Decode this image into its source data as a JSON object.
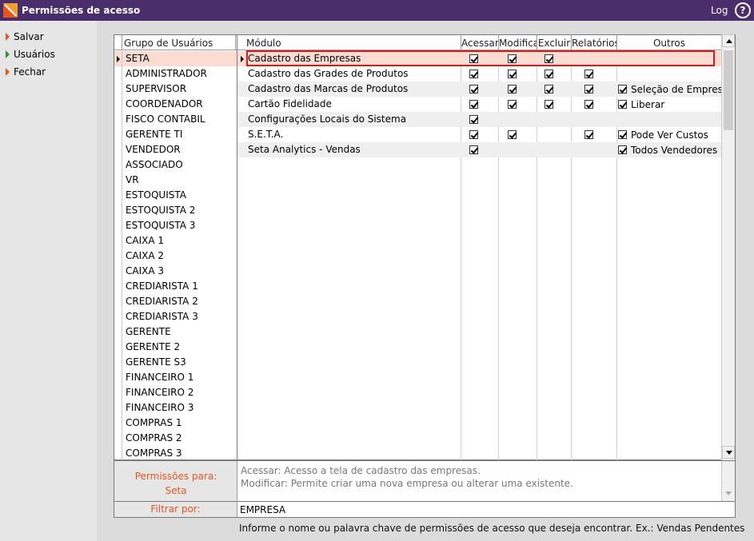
{
  "window": {
    "title": "Permissões de acesso",
    "log_label": "Log",
    "help_glyph": "?"
  },
  "sidebar": {
    "items": [
      {
        "label": "Salvar",
        "icon": "arrow-orange"
      },
      {
        "label": "Usuários",
        "icon": "arrow-green"
      },
      {
        "label": "Fechar",
        "icon": "arrow-orange"
      }
    ]
  },
  "groups": {
    "header": "Grupo de Usuários",
    "selected": 0,
    "items": [
      "SETA",
      "ADMINISTRADOR",
      "SUPERVISOR",
      "COORDENADOR",
      "FISCO CONTABIL",
      "GERENTE TI",
      "VENDEDOR",
      "ASSOCIADO",
      "VR",
      "ESTOQUISTA",
      "ESTOQUISTA 2",
      "ESTOQUISTA 3",
      "CAIXA 1",
      "CAIXA 2",
      "CAIXA 3",
      "CREDIARISTA 1",
      "CREDIARISTA 2",
      "CREDIARISTA 3",
      "GERENTE",
      "GERENTE 2",
      "GERENTE S3",
      "FINANCEIRO 1",
      "FINANCEIRO 2",
      "FINANCEIRO 3",
      "COMPRAS 1",
      "COMPRAS 2",
      "COMPRAS 3"
    ]
  },
  "modules": {
    "headers": {
      "modulo": "Módulo",
      "acessar": "Acessar",
      "modificar": "Modificar",
      "excluir": "Excluir",
      "relatorios": "Relatórios",
      "outros": "Outros"
    },
    "rows": [
      {
        "name": "Cadastro das Empresas",
        "acessar": true,
        "modificar": true,
        "excluir": true,
        "relatorios": false,
        "outros": []
      },
      {
        "name": "Cadastro das Grades de Produtos",
        "acessar": true,
        "modificar": true,
        "excluir": true,
        "relatorios": true,
        "outros": []
      },
      {
        "name": "Cadastro das Marcas de Produtos",
        "acessar": true,
        "modificar": true,
        "excluir": true,
        "relatorios": true,
        "outros": [
          "Seleção de Empresas"
        ]
      },
      {
        "name": "Cartão Fidelidade",
        "acessar": true,
        "modificar": true,
        "excluir": true,
        "relatorios": true,
        "outros": [
          "Liberar"
        ]
      },
      {
        "name": "Configurações Locais do Sistema",
        "acessar": true,
        "modificar": false,
        "excluir": false,
        "relatorios": false,
        "outros": []
      },
      {
        "name": "S.E.T.A.",
        "acessar": true,
        "modificar": true,
        "excluir": false,
        "relatorios": true,
        "outros": [
          "Pode Ver Custos"
        ]
      },
      {
        "name": "Seta Analytics - Vendas",
        "acessar": true,
        "modificar": false,
        "excluir": false,
        "relatorios": false,
        "outros": [
          "Todos Vendedores"
        ]
      }
    ]
  },
  "permissions": {
    "label_line1": "Permissões para:",
    "label_line2": "Seta",
    "desc_line1": "Acessar: Acesso a tela de cadastro das empresas.",
    "desc_line2": "Modificar: Permite criar uma nova empresa ou alterar uma existente."
  },
  "filter": {
    "label": "Filtrar por:",
    "value": "EMPRESA"
  },
  "hint": "Informe o nome ou palavra chave de permissões de acesso que deseja encontrar. Ex.: Vendas Pendentes",
  "colors": {
    "title_bg": "#4a2e6c",
    "accent": "#e8551d",
    "selection": "#fadcd2",
    "highlight_border": "#e01818"
  }
}
